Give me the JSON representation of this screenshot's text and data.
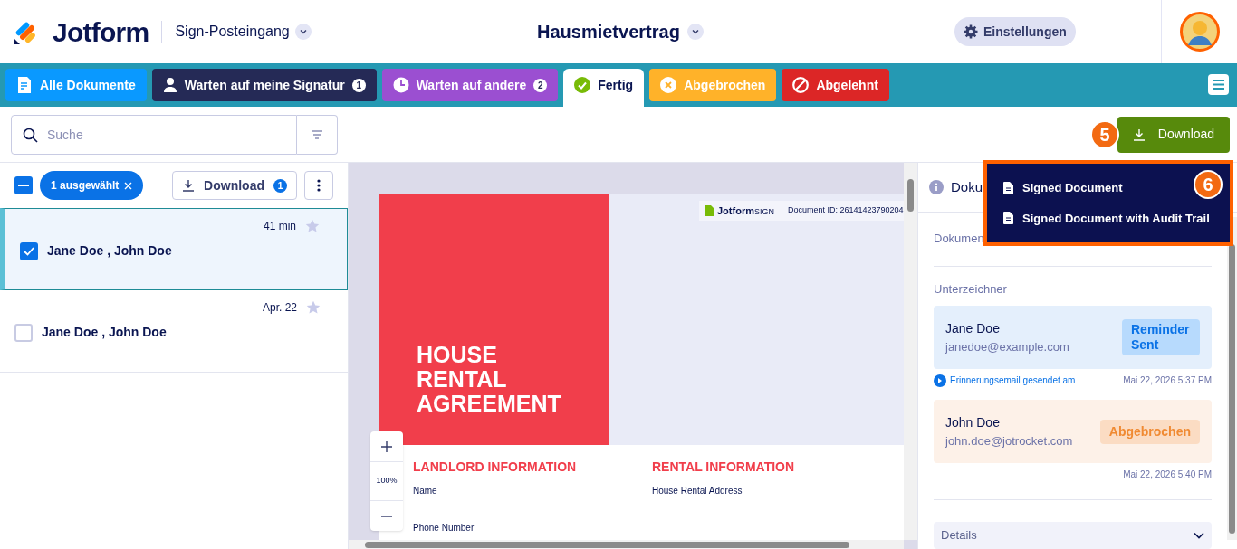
{
  "header": {
    "logo": "Jotform",
    "workspace": "Sign-Posteingang",
    "document_title": "Hausmietvertrag",
    "settings_button": "Einstellungen"
  },
  "tabs": [
    {
      "label": "Alle Dokumente",
      "kind": "all",
      "color": "#0a99ff",
      "selected": false
    },
    {
      "label": "Warten auf meine Signatur",
      "kind": "waiting_me",
      "color": "#252a56",
      "count": "1",
      "selected": false
    },
    {
      "label": "Warten auf andere",
      "kind": "waiting_others",
      "color": "#9b4fd1",
      "count": "2",
      "selected": false
    },
    {
      "label": "Fertig",
      "kind": "done",
      "color": "#ffffff",
      "selected": true
    },
    {
      "label": "Abgebrochen",
      "kind": "cancelled",
      "color": "#ffb229",
      "selected": false
    },
    {
      "label": "Abgelehnt",
      "kind": "declined",
      "color": "#dc2626",
      "selected": false
    }
  ],
  "toolbar": {
    "search_placeholder": "Suche",
    "download_button": "Download",
    "step": "5"
  },
  "list": {
    "select_all_indeterminate": true,
    "selection_chip": "1 ausgewählt",
    "download_button": "Download",
    "download_count": "1",
    "rows": [
      {
        "names": "Jane Doe , John Doe",
        "time": "41 min",
        "starred": false,
        "checked": true,
        "selected": true
      },
      {
        "names": "Jane Doe , John Doe",
        "time": "Apr. 22",
        "starred": false,
        "checked": false,
        "selected": false
      }
    ]
  },
  "document": {
    "brand": "Jotform",
    "brand_suffix": "SIGN",
    "document_id": "Document ID: 26141423790204",
    "title": "HOUSE RENTAL AGREEMENT",
    "zoom": "100%",
    "sections": [
      {
        "heading": "LANDLORD INFORMATION",
        "fields": [
          "Name",
          "Phone Number"
        ]
      },
      {
        "heading": "RENTAL INFORMATION",
        "fields": [
          "House Rental Address"
        ]
      }
    ]
  },
  "details_panel": {
    "title": "Doku",
    "status_label": "Dokumen",
    "signers_label": "Unterzeichner",
    "signers": [
      {
        "name": "Jane Doe",
        "email": "janedoe@example.com",
        "status": "Reminder Sent",
        "kind": "reminded",
        "note": "Erinnerungsemail gesendet am",
        "date": "Mai 22, 2026 5:37 PM"
      },
      {
        "name": "John Doe",
        "email": "john.doe@jotrocket.com",
        "status": "Abgebrochen",
        "kind": "cancelled",
        "date": "Mai 22, 2026 5:40 PM"
      }
    ],
    "details": "Details"
  },
  "download_menu": {
    "step": "6",
    "items": [
      "Signed Document",
      "Signed Document with Audit Trail"
    ]
  }
}
